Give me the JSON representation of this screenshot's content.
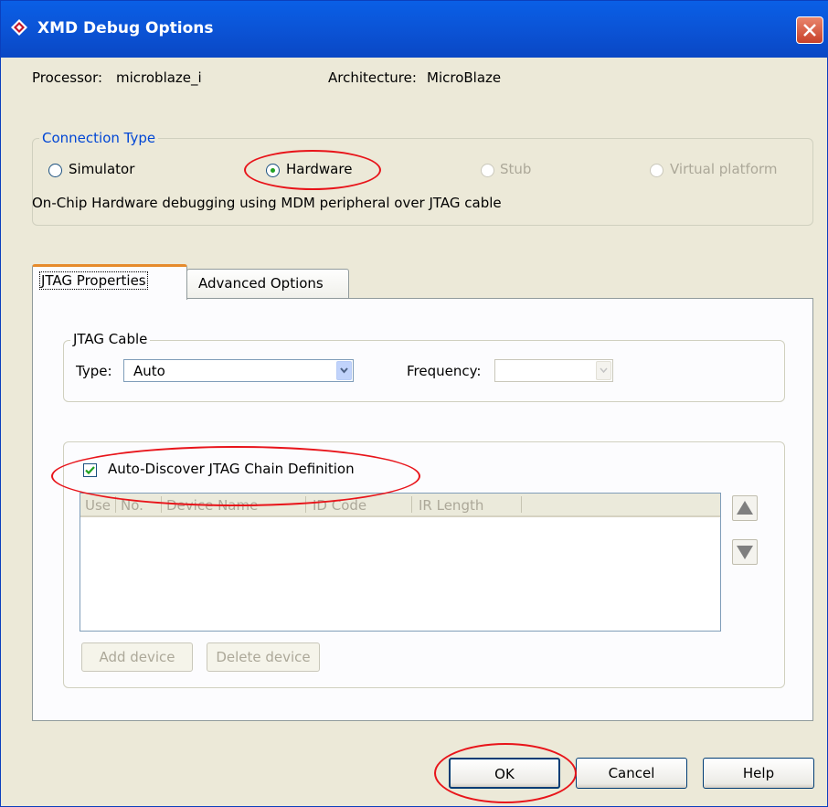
{
  "window": {
    "title": "XMD Debug Options"
  },
  "info": {
    "processor_label": "Processor:",
    "processor_value": "microblaze_i",
    "architecture_label": "Architecture:",
    "architecture_value": "MicroBlaze"
  },
  "connection": {
    "group_label": "Connection Type",
    "options": [
      {
        "label": "Simulator",
        "checked": false,
        "enabled": true
      },
      {
        "label": "Hardware",
        "checked": true,
        "enabled": true
      },
      {
        "label": "Stub",
        "checked": false,
        "enabled": false
      },
      {
        "label": "Virtual platform",
        "checked": false,
        "enabled": false
      }
    ],
    "description": "On-Chip Hardware debugging using MDM peripheral over JTAG cable"
  },
  "tabs": [
    {
      "label": "JTAG Properties",
      "active": true
    },
    {
      "label": "Advanced Options",
      "active": false
    }
  ],
  "jtag_cable": {
    "group_label": "JTAG Cable",
    "type_label": "Type:",
    "type_value": "Auto",
    "frequency_label": "Frequency:",
    "frequency_value": ""
  },
  "chain": {
    "auto_discover_label": "Auto-Discover JTAG Chain Definition",
    "auto_discover_checked": true,
    "columns": [
      "Use",
      "No.",
      "Device Name",
      "ID Code",
      "IR Length"
    ],
    "rows": [],
    "add_device_label": "Add device",
    "delete_device_label": "Delete device"
  },
  "footer": {
    "ok_label": "OK",
    "cancel_label": "Cancel",
    "help_label": "Help"
  },
  "colors": {
    "titlebar": "#0a55d8",
    "highlight_annotation": "#e8141a",
    "active_tab_accent": "#e68b2c",
    "radio_dot": "#21a121"
  }
}
